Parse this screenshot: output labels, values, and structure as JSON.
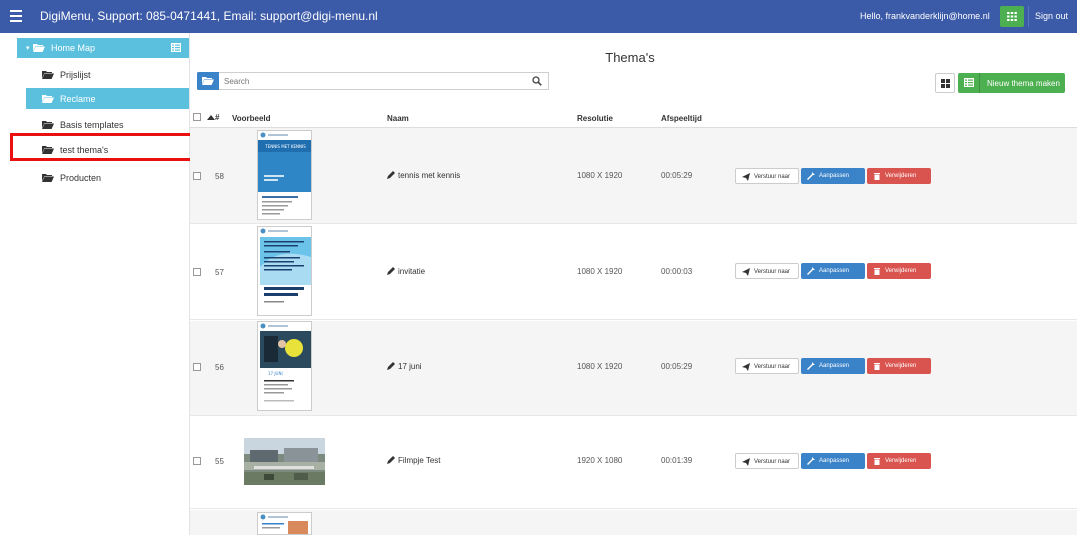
{
  "topbar": {
    "title": "DigiMenu, Support: 085-0471441, Email: support@digi-menu.nl",
    "greeting": "Hello, frankvanderklijn@home.nl",
    "signout_label": "Sign out"
  },
  "sidebar": {
    "root_label": "Home Map",
    "items": [
      {
        "label": "Prijslijst"
      },
      {
        "label": "Reclame"
      },
      {
        "label": "Basis templates"
      },
      {
        "label": "test thema's"
      },
      {
        "label": "Producten"
      }
    ]
  },
  "main": {
    "title": "Thema's",
    "search_placeholder": "Search",
    "new_theme_label": "Nieuw thema maken"
  },
  "table": {
    "headers": {
      "sort": "#",
      "preview": "Voorbeeld",
      "name": "Naam",
      "resolution": "Resolutie",
      "duration": "Afspeeltijd"
    },
    "rows": [
      {
        "id": "58",
        "name": "tennis met kennis",
        "resolution": "1080 X 1920",
        "duration": "00:05:29"
      },
      {
        "id": "57",
        "name": "invitatie",
        "resolution": "1080 X 1920",
        "duration": "00:00:03"
      },
      {
        "id": "56",
        "name": "17 juni",
        "resolution": "1080 X 1920",
        "duration": "00:05:29"
      },
      {
        "id": "55",
        "name": "Filmpje Test",
        "resolution": "1920 X 1080",
        "duration": "00:01:39"
      }
    ],
    "actions": {
      "send": "Verstuur naar",
      "edit": "Aanpassen",
      "delete": "Verwijderen"
    }
  },
  "thumb_texts": {
    "t58_headline": "TENNIS MET KENNIS",
    "t56_label": "17 JUNI"
  },
  "colors": {
    "topbar": "#3b5aa8",
    "sidebar_active": "#5bc0de",
    "success": "#4caf50",
    "primary": "#3b83c8",
    "danger": "#d9534f",
    "annotation": "#e8110f"
  }
}
